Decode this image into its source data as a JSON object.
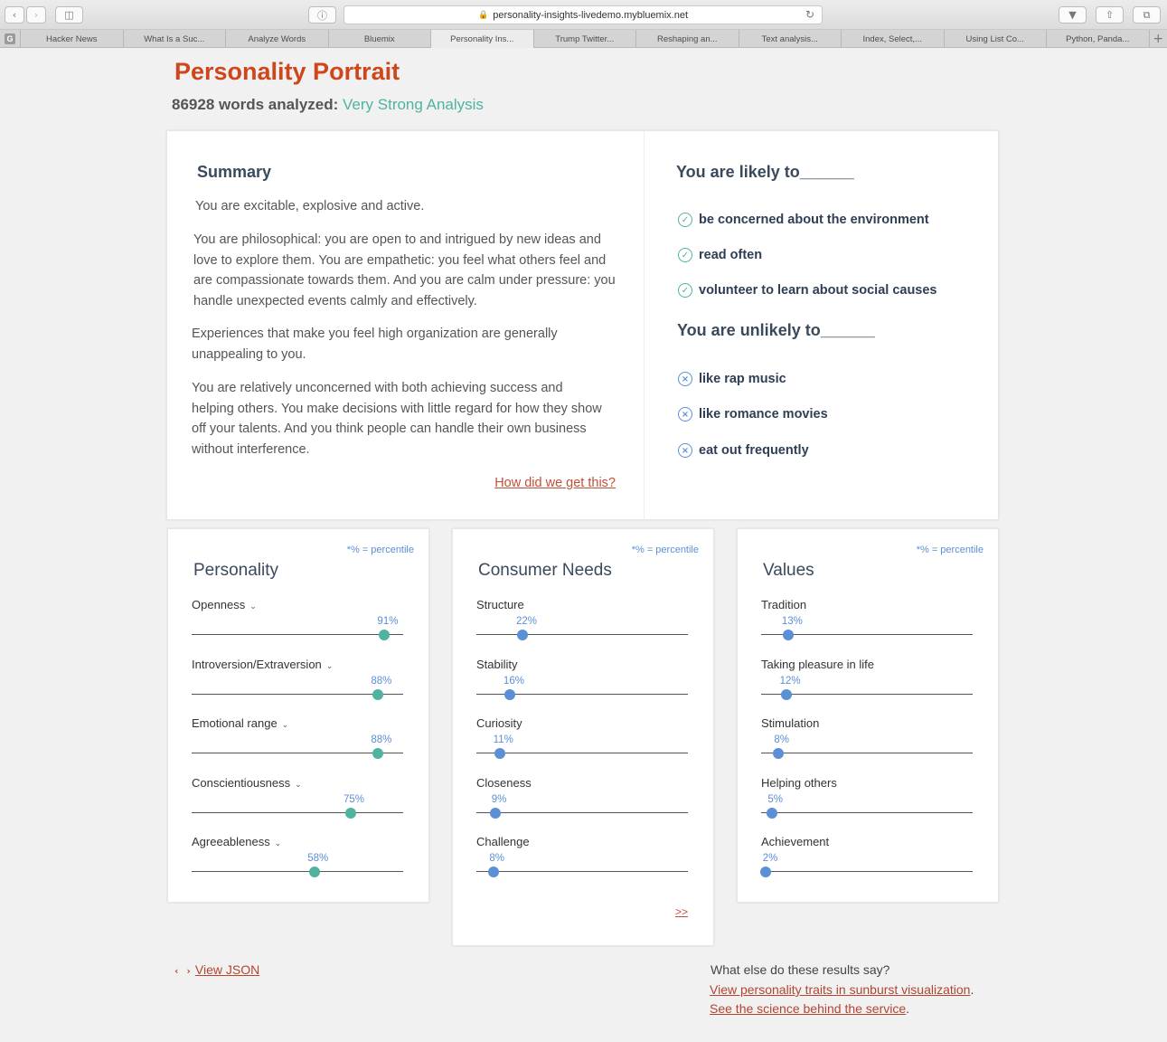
{
  "browser": {
    "url": "personality-insights-livedemo.mybluemix.net",
    "tabs": [
      "Hacker News",
      "What Is a Suc...",
      "Analyze Words",
      "Bluemix",
      "Personality Ins...",
      "Trump Twitter...",
      "Reshaping an...",
      "Text analysis...",
      "Index, Select,...",
      "Using List Co...",
      "Python, Panda..."
    ],
    "active_tab_index": 4,
    "new_tab_label": "+"
  },
  "header": {
    "title": "Personality Portrait",
    "word_count": "86928",
    "words_label": "words analyzed:",
    "strength": "Very Strong Analysis"
  },
  "summary": {
    "title": "Summary",
    "paragraphs": [
      "You are excitable, explosive and active.",
      "You are philosophical: you are open to and intrigued by new ideas and love to explore them. You are empathetic: you feel what others feel and are compassionate towards them. And you are calm under pressure: you handle unexpected events calmly and effectively.",
      "Experiences that make you feel high organization are generally unappealing to you.",
      "You are relatively unconcerned with both achieving success and helping others. You make decisions with little regard for how they show off your talents. And you think people can handle their own business without interference."
    ],
    "how_link": "How did we get this?"
  },
  "likely": {
    "title": "You are likely to______",
    "items": [
      "be concerned about the environment",
      "read often",
      "volunteer to learn about social causes"
    ]
  },
  "unlikely": {
    "title": "You are unlikely to______",
    "items": [
      "like rap music",
      "like romance movies",
      "eat out frequently"
    ]
  },
  "panels": {
    "personality": {
      "title": "Personality",
      "note": "*% = percentile",
      "dot_color": "#4fb3a0",
      "items": [
        {
          "label": "Openness",
          "pct": "91%",
          "value": 91
        },
        {
          "label": "Introversion/Extraversion",
          "pct": "88%",
          "value": 88
        },
        {
          "label": "Emotional range",
          "pct": "88%",
          "value": 88
        },
        {
          "label": "Conscientiousness",
          "pct": "75%",
          "value": 75
        },
        {
          "label": "Agreeableness",
          "pct": "58%",
          "value": 58
        }
      ]
    },
    "needs": {
      "title": "Consumer Needs",
      "note": "*% = percentile",
      "dot_color": "#5b8fd6",
      "more_link": ">>",
      "items": [
        {
          "label": "Structure",
          "pct": "22%",
          "value": 22
        },
        {
          "label": "Stability",
          "pct": "16%",
          "value": 16
        },
        {
          "label": "Curiosity",
          "pct": "11%",
          "value": 11
        },
        {
          "label": "Closeness",
          "pct": "9%",
          "value": 9
        },
        {
          "label": "Challenge",
          "pct": "8%",
          "value": 8
        }
      ]
    },
    "values": {
      "title": "Values",
      "note": "*% = percentile",
      "dot_color": "#5b8fd6",
      "items": [
        {
          "label": "Tradition",
          "pct": "13%",
          "value": 13
        },
        {
          "label": "Taking pleasure in life",
          "pct": "12%",
          "value": 12
        },
        {
          "label": "Stimulation",
          "pct": "8%",
          "value": 8
        },
        {
          "label": "Helping others",
          "pct": "5%",
          "value": 5
        },
        {
          "label": "Achievement",
          "pct": "2%",
          "value": 2
        }
      ]
    }
  },
  "footer": {
    "json_code": "‹ ›",
    "json_link": "View JSON",
    "question": "What else do these results say?",
    "sunburst_link": "View personality traits in sunburst visualization",
    "science_link": "See the science behind the service",
    "period": "."
  },
  "colors": {
    "accent": "#d0461c",
    "strength": "#4fb3a0",
    "link": "#b3452f",
    "blue": "#5b8fd6"
  }
}
